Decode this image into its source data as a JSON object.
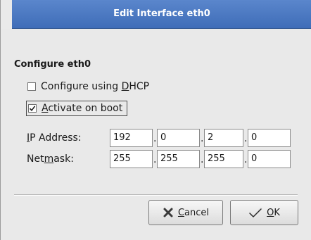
{
  "window": {
    "title": "Edit Interface eth0"
  },
  "section": {
    "title": "Configure eth0"
  },
  "options": {
    "dhcp": {
      "label_pre": "Configure using ",
      "label_mnemonic": "D",
      "label_post": "HCP",
      "checked": false
    },
    "activate": {
      "label_mnemonic": "A",
      "label_post": "ctivate on boot",
      "checked": true
    }
  },
  "fields": {
    "ip": {
      "label_mnemonic": "I",
      "label_post": "P Address:",
      "octets": [
        "192",
        "0",
        "2",
        "0"
      ]
    },
    "netmask": {
      "label_pre": "Net",
      "label_mnemonic": "m",
      "label_post": "ask:",
      "octets": [
        "255",
        "255",
        "255",
        "0"
      ]
    },
    "separator": "."
  },
  "buttons": {
    "cancel": {
      "label_mnemonic": "C",
      "label_post": "ancel",
      "icon": "cancel-x-icon"
    },
    "ok": {
      "label_mnemonic": "O",
      "label_post": "K",
      "icon": "ok-check-icon"
    }
  },
  "colors": {
    "titlebar": "#4a78c2",
    "cancel_icon": "#3a3a3a"
  }
}
